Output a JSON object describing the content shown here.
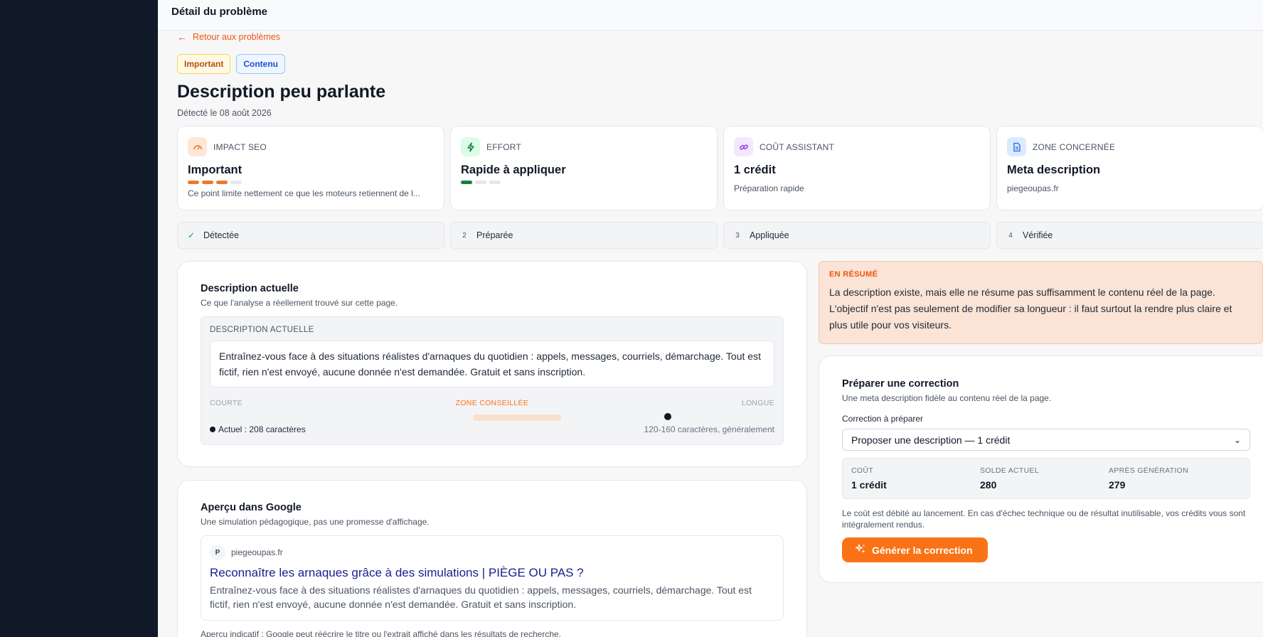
{
  "header": {
    "title": "Détail du problème"
  },
  "back_link": {
    "label": "Retour aux problèmes"
  },
  "badges": [
    {
      "label": "Important"
    },
    {
      "label": "Contenu"
    }
  ],
  "issue": {
    "title": "Description peu parlante",
    "detected": "Détecté le 08 août 2026"
  },
  "cards": [
    {
      "label": "IMPACT SEO",
      "value": "Important",
      "sub": "Ce point limite nettement ce que les moteurs retiennent de l...",
      "level": 3,
      "max": 4,
      "color": "#ea7a2e"
    },
    {
      "label": "EFFORT",
      "value": "Rapide à appliquer",
      "level": 1,
      "max": 3,
      "color": "#15803d"
    },
    {
      "label": "COÛT ASSISTANT",
      "value": "1 crédit",
      "sub": "Préparation rapide"
    },
    {
      "label": "ZONE CONCERNÉE",
      "value": "Meta description",
      "sub": "piegeoupas.fr"
    }
  ],
  "steps": [
    {
      "num": "",
      "label": "Détectée"
    },
    {
      "num": "2",
      "label": "Préparée"
    },
    {
      "num": "3",
      "label": "Appliquée"
    },
    {
      "num": "4",
      "label": "Vérifiée"
    }
  ],
  "current_description": {
    "title": "Description actuelle",
    "subtitle": "Ce que l'analyse a réellement trouvé sur cette page.",
    "box_label": "DESCRIPTION ACTUELLE",
    "text": "Entraînez-vous face à des situations réalistes d'arnaques du quotidien : appels, messages, courriels, démarchage. Tout est fictif, rien n'est envoyé, aucune donnée n'est demandée. Gratuit et sans inscription.",
    "scale_short": "COURTE",
    "scale_zone": "ZONE CONSEILLÉE",
    "scale_long": "LONGUE",
    "current_count": "Actuel : 208 caractères",
    "recommended": "120-160 caractères, généralement"
  },
  "google_preview": {
    "title": "Aperçu dans Google",
    "subtitle": "Une simulation pédagogique, pas une promesse d'affichage.",
    "favicon_letter": "P",
    "site": "piegeoupas.fr",
    "result_title": "Reconnaître les arnaques grâce à des simulations | PIÈGE OU PAS ?",
    "snippet": "Entraînez-vous face à des situations réalistes d'arnaques du quotidien : appels, messages, courriels, démarchage. Tout est fictif, rien n'est envoyé, aucune donnée n'est demandée. Gratuit et sans inscription.",
    "note": "Aperçu indicatif : Google peut réécrire le titre ou l'extrait affiché dans les résultats de recherche."
  },
  "summary": {
    "tag": "EN RÉSUMÉ",
    "text": "La description existe, mais elle ne résume pas suffisamment le contenu réel de la page. L'objectif n'est pas seulement de modifier sa longueur : il faut surtout la rendre plus claire et plus utile pour vos visiteurs."
  },
  "prepare": {
    "title": "Préparer une correction",
    "subtitle": "Une meta description fidèle au contenu réel de la page.",
    "field_label": "Correction à préparer",
    "selected_option": "Proposer une description — 1 crédit",
    "cost_label": "COÛT",
    "cost_value": "1 crédit",
    "balance_label": "SOLDE ACTUEL",
    "balance_value": "280",
    "after_label": "APRÈS GÉNÉRATION",
    "after_value": "279",
    "note": "Le coût est débité au lancement. En cas d'échec technique ou de résultat inutilisable, vos crédits vous sont intégralement rendus.",
    "button_label": "Générer la correction"
  }
}
